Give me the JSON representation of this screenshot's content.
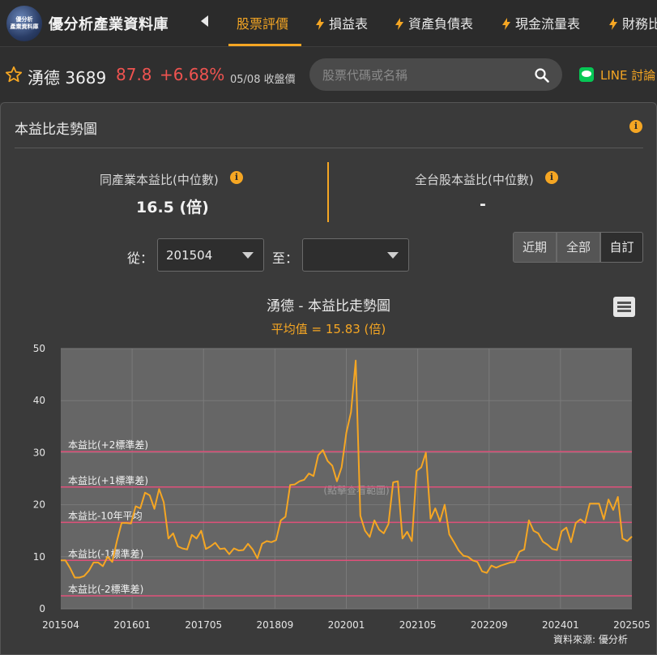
{
  "nav": {
    "logo_lines": [
      "優分析",
      "產業資料庫"
    ],
    "brand": "優分析產業資料庫",
    "tabs": [
      {
        "label": "股票評價",
        "active": true
      },
      {
        "label": "損益表",
        "active": false
      },
      {
        "label": "資產負債表",
        "active": false
      },
      {
        "label": "現金流量表",
        "active": false
      },
      {
        "label": "財務比",
        "active": false
      }
    ]
  },
  "stock": {
    "name_code": "湧德 3689",
    "price": "87.8",
    "change": "+6.68%",
    "date_label": "05/08 收盤價",
    "search_placeholder": "股票代碼或名稱",
    "line_label": "LINE 討論"
  },
  "card": {
    "title": "本益比走勢圖",
    "industry_label": "同產業本益比(中位數)",
    "industry_value": "16.5 (倍)",
    "market_label": "全台股本益比(中位數)",
    "market_value": "-",
    "from_label": "從：",
    "from_value": "201504",
    "to_label": "至：",
    "to_value": "",
    "range_buttons": [
      {
        "label": "近期",
        "selected": false
      },
      {
        "label": "全部",
        "selected": false
      },
      {
        "label": "自訂",
        "selected": true
      }
    ],
    "source": "資料來源: 優分析"
  },
  "colors": {
    "accent": "#f5a623",
    "up": "#ef5350",
    "band_line": "#e0507a"
  },
  "chart_data": {
    "type": "line",
    "title": "湧德 - 本益比走勢圖",
    "subtitle": "平均值 = 15.83 (倍)",
    "ylim": [
      0,
      50
    ],
    "yticks": [
      0,
      10,
      20,
      30,
      40,
      50
    ],
    "xticks": [
      "201504",
      "201601",
      "201705",
      "201809",
      "202001",
      "202105",
      "202209",
      "202401",
      "202505"
    ],
    "watermark": "(點擊查看範圍)",
    "grid": true,
    "bands": [
      {
        "label": "本益比(+2標準差)",
        "value": 30.2
      },
      {
        "label": "本益比(+1標準差)",
        "value": 23.4
      },
      {
        "label": "本益比-10年平均",
        "value": 16.6
      },
      {
        "label": "本益比(-1標準差)",
        "value": 9.3
      },
      {
        "label": "本益比(-2標準差)",
        "value": 2.5
      }
    ],
    "series": [
      {
        "values": [
          9.3,
          9.3,
          7.8,
          6.0,
          6.0,
          6.3,
          7.3,
          8.9,
          8.9,
          8.2,
          10.0,
          9.0,
          13.0,
          16.5,
          16.5,
          16.4,
          19.7,
          19.3,
          22.3,
          21.8,
          19.2,
          23.0,
          20.5,
          13.5,
          14.5,
          12.0,
          11.6,
          11.4,
          14.2,
          13.5,
          15.0,
          11.5,
          12.0,
          12.7,
          11.5,
          11.6,
          10.5,
          11.6,
          11.2,
          11.3,
          12.5,
          11.4,
          9.7,
          12.5,
          13.0,
          12.8,
          13.2,
          17.0,
          17.7,
          23.8,
          23.9,
          24.5,
          24.8,
          26.0,
          25.5,
          29.5,
          30.5,
          28.4,
          27.5,
          24.5,
          27.2,
          33.8,
          37.8,
          47.7,
          17.9,
          15.0,
          13.8,
          17.0,
          15.2,
          14.5,
          16.3,
          24.3,
          24.5,
          13.5,
          14.8,
          13.0,
          26.5,
          27.2,
          30.0,
          17.3,
          19.3,
          16.8,
          20.0,
          14.3,
          12.8,
          11.2,
          10.2,
          10.0,
          9.3,
          9.0,
          7.2,
          6.9,
          8.3,
          7.9,
          8.3,
          8.6,
          8.9,
          9.0,
          11.0,
          11.4,
          17.0,
          15.0,
          14.5,
          12.9,
          12.3,
          11.5,
          11.3,
          14.9,
          15.6,
          12.8,
          16.5,
          17.2,
          16.5,
          20.2,
          20.2,
          20.2,
          17.2,
          21.0,
          19.0,
          21.5,
          13.5,
          13.0,
          13.9
        ]
      }
    ]
  }
}
